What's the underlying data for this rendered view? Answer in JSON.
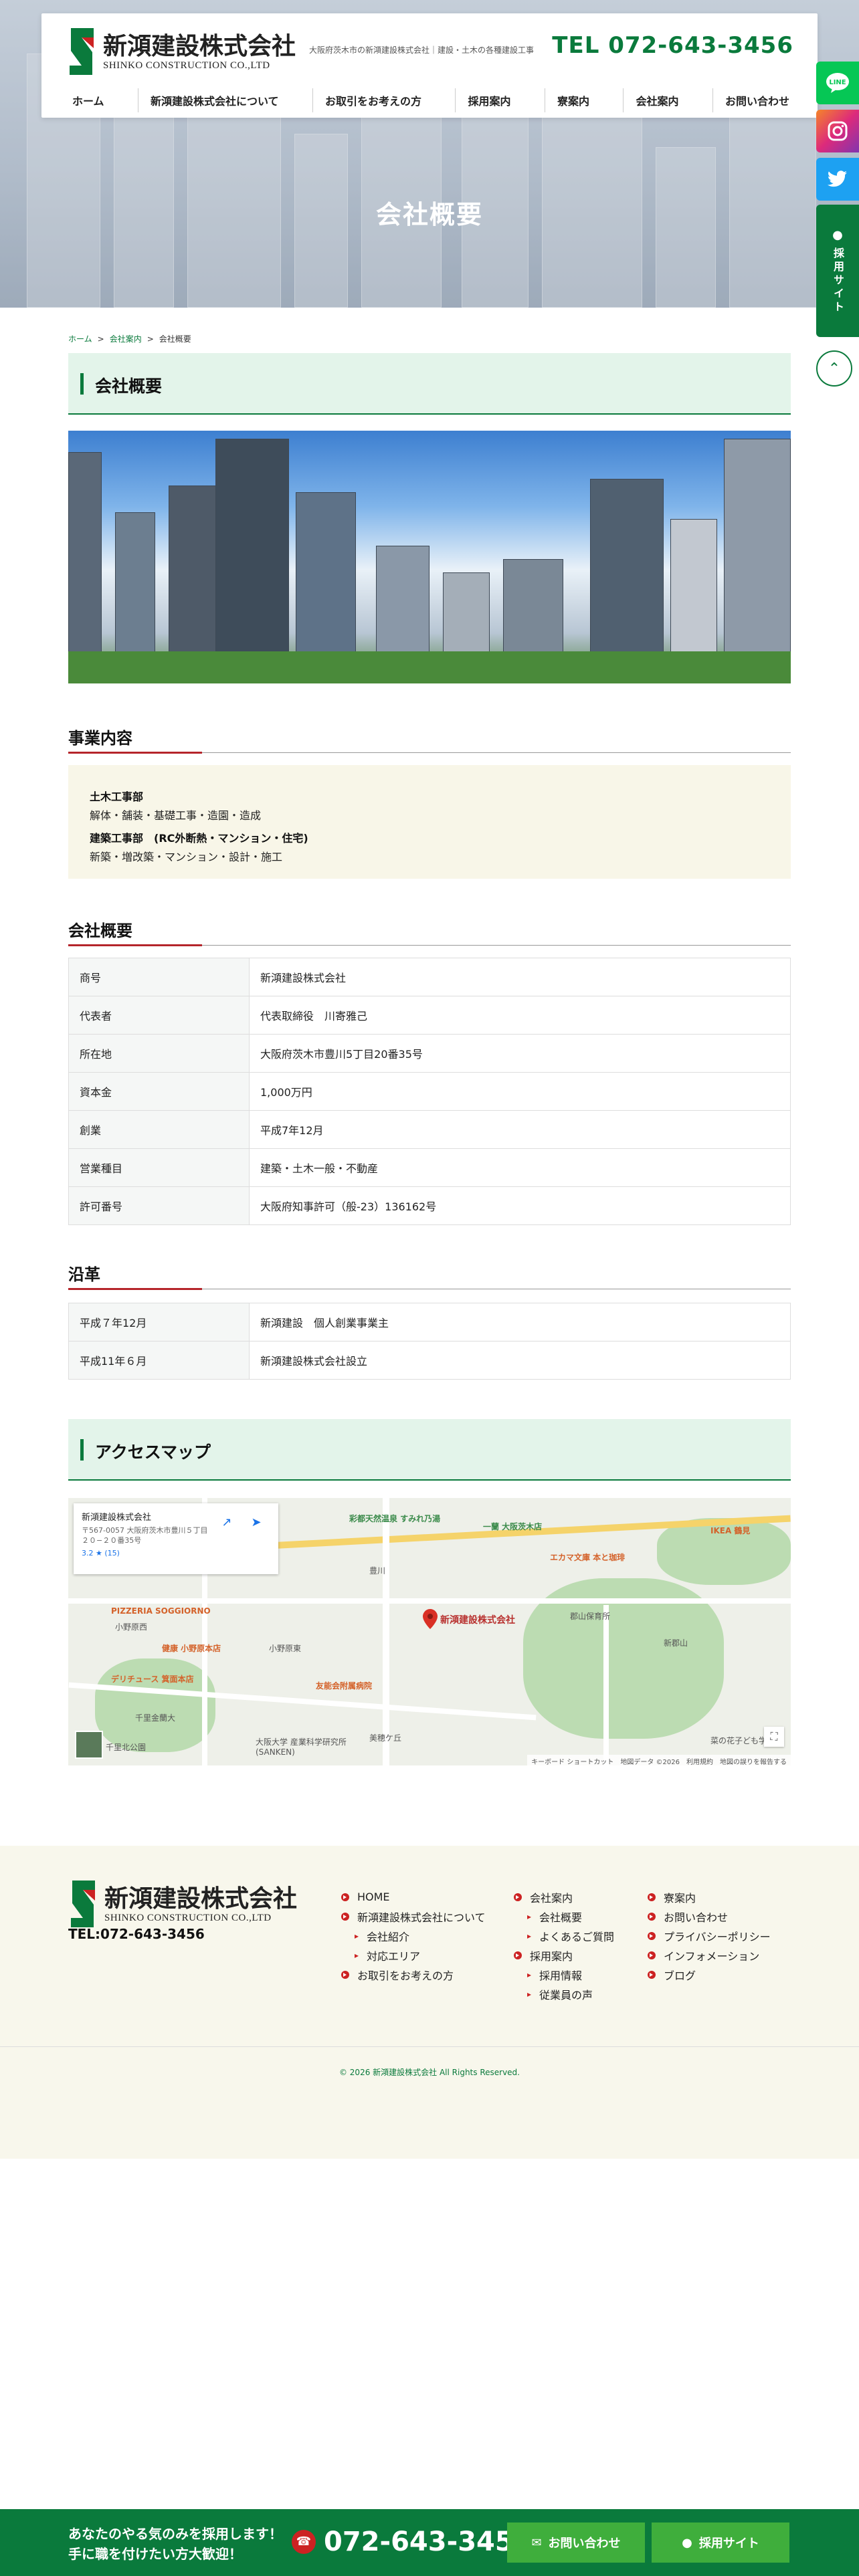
{
  "header": {
    "logo_jp": "新澒建設株式会社",
    "logo_en": "SHINKO CONSTRUCTION CO.,LTD",
    "tagline": "大阪府茨木市の新澒建設株式会社｜建設・土木の各種建設工事",
    "tel": "TEL 072-643-3456",
    "nav": [
      "ホーム",
      "新澒建設株式会社について",
      "お取引をお考えの方",
      "採用案内",
      "寮案内",
      "会社案内",
      "お問い合わせ"
    ]
  },
  "hero": {
    "title": "会社概要"
  },
  "side": {
    "line": "LINE",
    "recruit": "採用サイト"
  },
  "breadcrumb": {
    "home": "ホーム",
    "parent": "会社案内",
    "current": "会社概要",
    "sep": ">"
  },
  "page_heading": "会社概要",
  "business": {
    "heading": "事業内容",
    "items": [
      {
        "title": "土木工事部",
        "desc": "解体・舗装・基礎工事・造園・造成"
      },
      {
        "title": "建築工事部　(RC外断熱・マンション・住宅)",
        "desc": "新築・増改築・マンション・設計・施工"
      }
    ]
  },
  "company": {
    "heading": "会社概要",
    "rows": [
      {
        "k": "商号",
        "v": "新澒建設株式会社"
      },
      {
        "k": "代表者",
        "v": "代表取締役　川寄雅己"
      },
      {
        "k": "所在地",
        "v": "大阪府茨木市豊川5丁目20番35号"
      },
      {
        "k": "資本金",
        "v": "1,000万円"
      },
      {
        "k": "創業",
        "v": "平成7年12月"
      },
      {
        "k": "営業種目",
        "v": "建築・土木一般・不動産"
      },
      {
        "k": "許可番号",
        "v": "大阪府知事許可（般-23）136162号"
      }
    ]
  },
  "history": {
    "heading": "沿革",
    "rows": [
      {
        "k": "平成７年12月",
        "v": "新澒建設　個人創業事業主"
      },
      {
        "k": "平成11年６月",
        "v": "新澒建設株式会社設立"
      }
    ]
  },
  "access": {
    "heading": "アクセスマップ",
    "card_name": "新澒建設株式会社",
    "card_address": "〒567-0057 大阪府茨木市豊川５丁目２０−２０番35号",
    "card_rating": "3.2 ★ (15)",
    "pin_label": "新澒建設株式会社",
    "labels": [
      "彩都天然温泉 すみれ乃湯",
      "一蘭 大阪茨木店",
      "IKEA 鶴見",
      "エカマ文庫 本と珈琲",
      "PIZZERIA SOGGIORNO",
      "小野原西",
      "小野原東",
      "郡山保育所",
      "豊川",
      "新郡山",
      "デリチュース 箕面本店",
      "健康 小野原本店",
      "友能会附属病院",
      "千里金蘭大",
      "美穂ケ丘",
      "大阪大学 産業科学研究所(SANKEN)",
      "千里北公園",
      "菜の花子ども学園"
    ],
    "footer": "キーボード ショートカット　地図データ ©2026　利用規約　地図の誤りを報告する"
  },
  "footer": {
    "logo_jp": "新澒建設株式会社",
    "logo_en": "SHINKO CONSTRUCTION CO.,LTD",
    "tel": "TEL:072-643-3456",
    "col1": [
      {
        "label": "HOME",
        "sub": false
      },
      {
        "label": "新澒建設株式会社について",
        "sub": false
      },
      {
        "label": "会社紹介",
        "sub": true
      },
      {
        "label": "対応エリア",
        "sub": true
      },
      {
        "label": "お取引をお考えの方",
        "sub": false
      }
    ],
    "col2": [
      {
        "label": "会社案内",
        "sub": false
      },
      {
        "label": "会社概要",
        "sub": true
      },
      {
        "label": "よくあるご質問",
        "sub": true
      },
      {
        "label": "採用案内",
        "sub": false
      },
      {
        "label": "採用情報",
        "sub": true
      },
      {
        "label": "従業員の声",
        "sub": true
      }
    ],
    "col3": [
      {
        "label": "寮案内",
        "sub": false
      },
      {
        "label": "お問い合わせ",
        "sub": false
      },
      {
        "label": "プライバシーポリシー",
        "sub": false
      },
      {
        "label": "インフォメーション",
        "sub": false
      },
      {
        "label": "ブログ",
        "sub": false
      }
    ],
    "copyright": "© 2026 新澒建設株式会社 All Rights Reserved."
  },
  "bottom_bar": {
    "msg_line1": "あなたのやる気のみを採用します！",
    "msg_line2": "手に職を付けたい方大歓迎！",
    "tel": "072-643-3456",
    "contact_label": "お問い合わせ",
    "recruit_label": "採用サイト"
  },
  "colors": {
    "brand_green": "#0a7a3c",
    "accent_red": "#b5252b",
    "light_green_bg": "#e3f4ea",
    "cream_bg": "#f8f6e8"
  }
}
